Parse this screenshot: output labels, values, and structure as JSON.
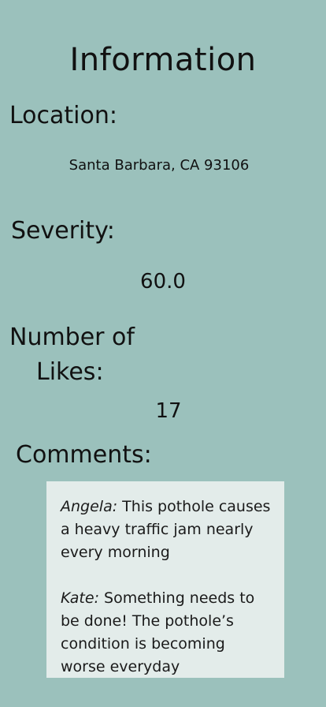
{
  "page": {
    "title": "Information"
  },
  "location": {
    "label": "Location:",
    "value": "Santa Barbara, CA 93106"
  },
  "severity": {
    "label": "Severity:",
    "value": "60.0"
  },
  "likes": {
    "label_line1": "Number of",
    "label_line2": "Likes:",
    "value": "17"
  },
  "comments": {
    "label": "Comments:",
    "items": [
      {
        "author": "Angela:",
        "text": " This pothole causes a heavy traffic jam nearly every morning"
      },
      {
        "author": "Kate:",
        "text": " Something needs to be done! The pothole’s condition is becoming worse everyday"
      }
    ]
  },
  "colors": {
    "background": "#9bc1bc",
    "comment_box": "#e3ecea",
    "text": "#111111"
  }
}
